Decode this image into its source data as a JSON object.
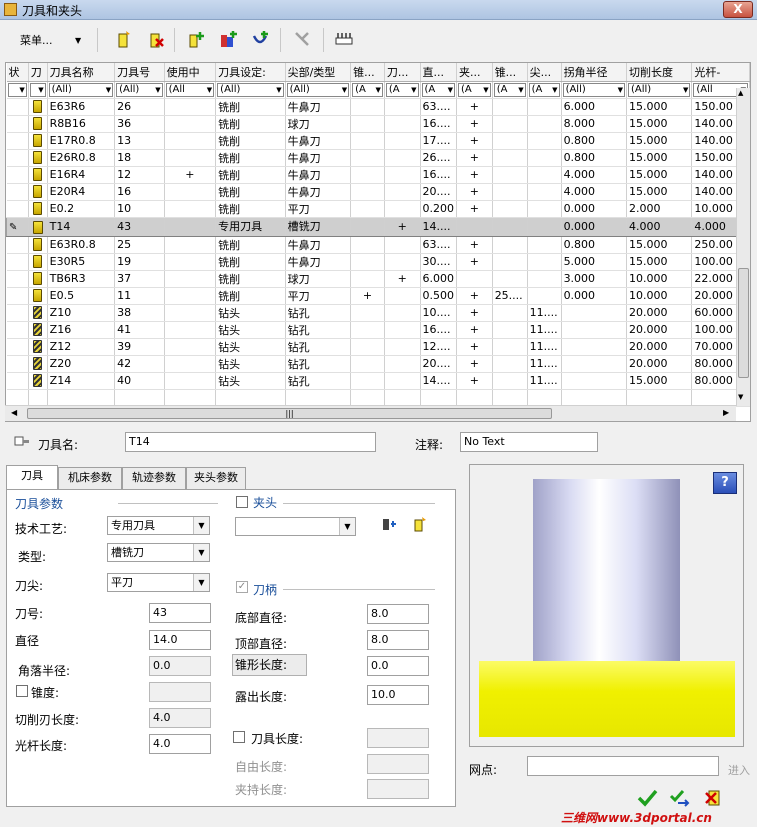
{
  "window": {
    "title": "刀具和夹头",
    "close": "X"
  },
  "toolbar": {
    "menu_label": "菜单...",
    "menu_arrow": "▼"
  },
  "columns": [
    "状",
    "刀",
    "刀具名称",
    "刀具号",
    "使用中",
    "刀具设定:",
    "尖部/类型",
    "锥...",
    "刀...",
    "直...",
    "夹...",
    "锥...",
    "尖...",
    "拐角半径",
    "切削长度",
    "光杆-"
  ],
  "filters": [
    "▼",
    "▼",
    "(All)",
    "(All)",
    "(All",
    "(All)",
    "(All)",
    "(A",
    "(A",
    "(A",
    "(A",
    "(A",
    "(A",
    "(All)",
    "(All)",
    "(All"
  ],
  "rows": [
    {
      "icon": "mill",
      "name": "E63R6",
      "no": "26",
      "inuse": "",
      "set": "铣削",
      "tip": "牛鼻刀",
      "c8": "",
      "c9": "",
      "dia": "63....",
      "c11": "+",
      "c12": "",
      "c13": "",
      "corner": "6.000",
      "cut": "15.000",
      "shank": "150.00"
    },
    {
      "icon": "mill",
      "name": "R8B16",
      "no": "36",
      "inuse": "",
      "set": "铣削",
      "tip": "球刀",
      "c8": "",
      "c9": "",
      "dia": "16....",
      "c11": "+",
      "c12": "",
      "c13": "",
      "corner": "8.000",
      "cut": "15.000",
      "shank": "140.00"
    },
    {
      "icon": "mill",
      "name": "E17R0.8",
      "no": "13",
      "inuse": "",
      "set": "铣削",
      "tip": "牛鼻刀",
      "c8": "",
      "c9": "",
      "dia": "17....",
      "c11": "+",
      "c12": "",
      "c13": "",
      "corner": "0.800",
      "cut": "15.000",
      "shank": "140.00"
    },
    {
      "icon": "mill",
      "name": "E26R0.8",
      "no": "18",
      "inuse": "",
      "set": "铣削",
      "tip": "牛鼻刀",
      "c8": "",
      "c9": "",
      "dia": "26....",
      "c11": "+",
      "c12": "",
      "c13": "",
      "corner": "0.800",
      "cut": "15.000",
      "shank": "150.00"
    },
    {
      "icon": "mill",
      "name": "E16R4",
      "no": "12",
      "inuse": "+",
      "set": "铣削",
      "tip": "牛鼻刀",
      "c8": "",
      "c9": "",
      "dia": "16....",
      "c11": "+",
      "c12": "",
      "c13": "",
      "corner": "4.000",
      "cut": "15.000",
      "shank": "140.00"
    },
    {
      "icon": "mill",
      "name": "E20R4",
      "no": "16",
      "inuse": "",
      "set": "铣削",
      "tip": "牛鼻刀",
      "c8": "",
      "c9": "",
      "dia": "20....",
      "c11": "+",
      "c12": "",
      "c13": "",
      "corner": "4.000",
      "cut": "15.000",
      "shank": "140.00"
    },
    {
      "icon": "mill",
      "name": "E0.2",
      "no": "10",
      "inuse": "",
      "set": "铣削",
      "tip": "平刀",
      "c8": "",
      "c9": "",
      "dia": "0.200",
      "c11": "+",
      "c12": "",
      "c13": "",
      "corner": "0.000",
      "cut": "2.000",
      "shank": "10.000"
    },
    {
      "icon": "spec",
      "name": "T14",
      "no": "43",
      "inuse": "",
      "set": "专用刀具",
      "tip": "槽铣刀",
      "c8": "",
      "c9": "+",
      "dia": "14....",
      "c11": "",
      "c12": "",
      "c13": "",
      "corner": "0.000",
      "cut": "4.000",
      "shank": "4.000",
      "selected": true
    },
    {
      "icon": "mill",
      "name": "E63R0.8",
      "no": "25",
      "inuse": "",
      "set": "铣削",
      "tip": "牛鼻刀",
      "c8": "",
      "c9": "",
      "dia": "63....",
      "c11": "+",
      "c12": "",
      "c13": "",
      "corner": "0.800",
      "cut": "15.000",
      "shank": "250.00"
    },
    {
      "icon": "mill",
      "name": "E30R5",
      "no": "19",
      "inuse": "",
      "set": "铣削",
      "tip": "牛鼻刀",
      "c8": "",
      "c9": "",
      "dia": "30....",
      "c11": "+",
      "c12": "",
      "c13": "",
      "corner": "5.000",
      "cut": "15.000",
      "shank": "100.00"
    },
    {
      "icon": "mill",
      "name": "TB6R3",
      "no": "37",
      "inuse": "",
      "set": "铣削",
      "tip": "球刀",
      "c8": "",
      "c9": "+",
      "dia": "6.000",
      "c11": "",
      "c12": "",
      "c13": "",
      "corner": "3.000",
      "cut": "10.000",
      "shank": "22.000"
    },
    {
      "icon": "mill",
      "name": "E0.5",
      "no": "11",
      "inuse": "",
      "set": "铣削",
      "tip": "平刀",
      "c8": "+",
      "c9": "",
      "dia": "0.500",
      "c11": "+",
      "c12": "25....",
      "c13": "",
      "corner": "0.000",
      "cut": "10.000",
      "shank": "20.000"
    },
    {
      "icon": "drill",
      "name": "Z10",
      "no": "38",
      "inuse": "",
      "set": "钻头",
      "tip": "钻孔",
      "c8": "",
      "c9": "",
      "dia": "10....",
      "c11": "+",
      "c12": "",
      "c13": "11....",
      "corner": "",
      "cut": "20.000",
      "shank": "60.000"
    },
    {
      "icon": "drill",
      "name": "Z16",
      "no": "41",
      "inuse": "",
      "set": "钻头",
      "tip": "钻孔",
      "c8": "",
      "c9": "",
      "dia": "16....",
      "c11": "+",
      "c12": "",
      "c13": "11....",
      "corner": "",
      "cut": "20.000",
      "shank": "100.00"
    },
    {
      "icon": "drill",
      "name": "Z12",
      "no": "39",
      "inuse": "",
      "set": "钻头",
      "tip": "钻孔",
      "c8": "",
      "c9": "",
      "dia": "12....",
      "c11": "+",
      "c12": "",
      "c13": "11....",
      "corner": "",
      "cut": "20.000",
      "shank": "70.000"
    },
    {
      "icon": "drill",
      "name": "Z20",
      "no": "42",
      "inuse": "",
      "set": "钻头",
      "tip": "钻孔",
      "c8": "",
      "c9": "",
      "dia": "20....",
      "c11": "+",
      "c12": "",
      "c13": "11....",
      "corner": "",
      "cut": "20.000",
      "shank": "80.000"
    },
    {
      "icon": "drill",
      "name": "Z14",
      "no": "40",
      "inuse": "",
      "set": "钻头",
      "tip": "钻孔",
      "c8": "",
      "c9": "",
      "dia": "14....",
      "c11": "+",
      "c12": "",
      "c13": "11....",
      "corner": "",
      "cut": "15.000",
      "shank": "80.000"
    }
  ],
  "scroll": {
    "grip": "|||"
  },
  "tool_name": {
    "label": "刀具名:",
    "value": "T14"
  },
  "note": {
    "label": "注释:",
    "value": "No Text"
  },
  "tabs": [
    "刀具",
    "机床参数",
    "轨迹参数",
    "夹头参数"
  ],
  "tool_params": {
    "title": "刀具参数",
    "process_label": "技术工艺:",
    "process_value": "专用刀具",
    "type_label": "类型:",
    "type_value": "槽铣刀",
    "tip_label": "刀尖:",
    "tip_value": "平刀",
    "toolno_label": "刀号:",
    "toolno_value": "43",
    "dia_label": "直径",
    "dia_value": "14.0",
    "corner_label": "角落半径:",
    "corner_value": "0.0",
    "taper_label": "锥度:",
    "taper_value": "",
    "cutlen_label": "切削刃长度:",
    "cutlen_value": "4.0",
    "shanklen_label": "光杆长度:",
    "shanklen_value": "4.0"
  },
  "holder_section": {
    "title": "夹头",
    "value": ""
  },
  "shank_section": {
    "title": "刀柄",
    "bottom_dia_label": "底部直径:",
    "bottom_dia_value": "8.0",
    "top_dia_label": "顶部直径:",
    "top_dia_value": "8.0",
    "taper_len_label": "锥形长度:",
    "taper_len_value": "0.0",
    "exposed_label": "露出长度:",
    "exposed_value": "10.0",
    "toollen_label": "刀具长度:",
    "toollen_value": "",
    "free_label": "自由长度:",
    "free_value": "",
    "clamp_label": "夹持长度:",
    "clamp_value": ""
  },
  "help": "?",
  "webpoint": {
    "label": "网点:",
    "value": "",
    "enter": "进入"
  },
  "watermark": "三维网www.3dportal.cn",
  "colors": {
    "holder_yellow": "#f0f000",
    "selected_row": "#cfcfcf",
    "group_title": "#1a4f9a"
  }
}
